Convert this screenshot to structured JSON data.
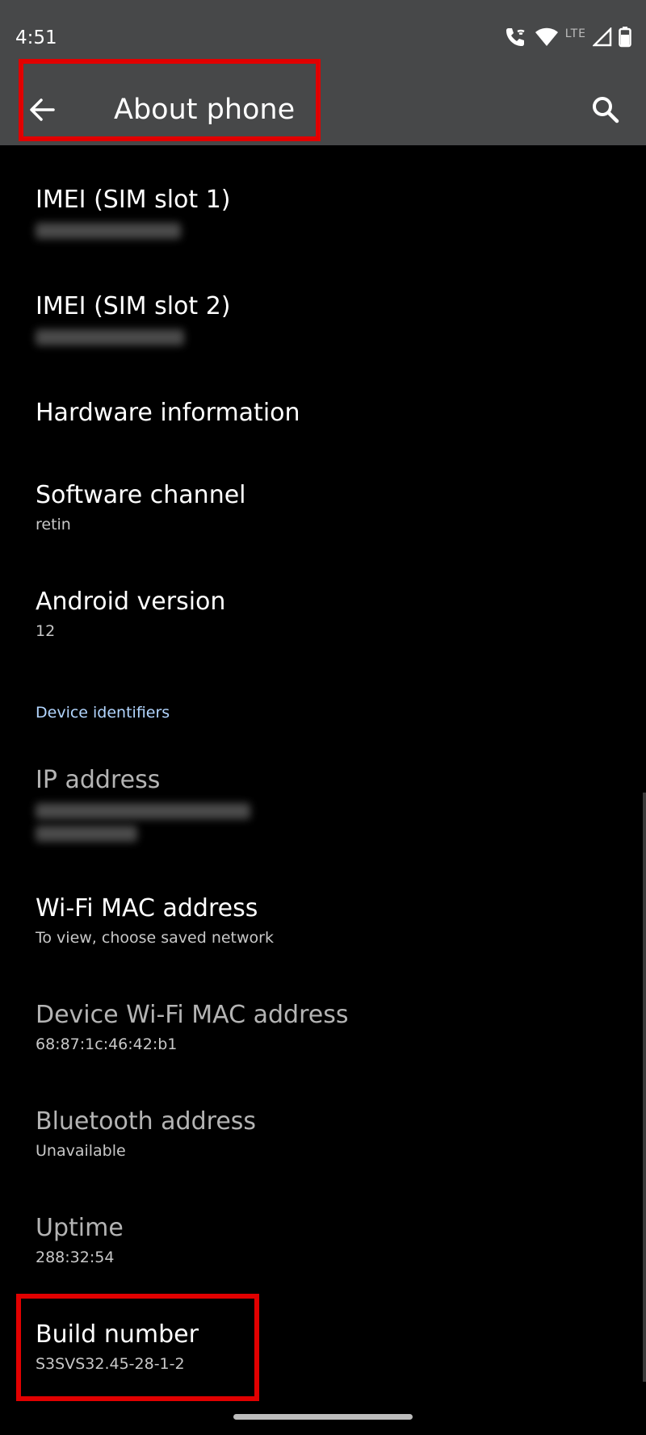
{
  "status_bar": {
    "time": "4:51",
    "network_label": "LTE",
    "icons": [
      "wifi-calling-icon",
      "wifi-icon",
      "cellular-signal-icon",
      "battery-icon"
    ]
  },
  "app_bar": {
    "title": "About phone",
    "back_icon": "arrow-back-icon",
    "search_icon": "search-icon"
  },
  "colors": {
    "app_bar_bg": "#474849",
    "background": "#000000",
    "highlight": "#e10000",
    "section_header": "#b3d6ff"
  },
  "items": [
    {
      "title": "IMEI (SIM slot 1)",
      "subtitle": "",
      "redacted": true
    },
    {
      "title": "IMEI (SIM slot 2)",
      "subtitle": "",
      "redacted": true
    },
    {
      "title": "Hardware information",
      "subtitle": ""
    },
    {
      "title": "Software channel",
      "subtitle": "retin"
    },
    {
      "title": "Android version",
      "subtitle": "12"
    }
  ],
  "section_header": "Device identifiers",
  "identifier_items": [
    {
      "title": "IP address",
      "subtitle": "",
      "redacted": true,
      "disabled": true
    },
    {
      "title": "Wi-Fi MAC address",
      "subtitle": "To view, choose saved network",
      "disabled": false
    },
    {
      "title": "Device Wi-Fi MAC address",
      "subtitle": "68:87:1c:46:42:b1",
      "disabled": true
    },
    {
      "title": "Bluetooth address",
      "subtitle": "Unavailable",
      "disabled": true
    },
    {
      "title": "Uptime",
      "subtitle": "288:32:54",
      "disabled": true
    },
    {
      "title": "Build number",
      "subtitle": "S3SVS32.45-28-1-2",
      "disabled": false
    }
  ]
}
